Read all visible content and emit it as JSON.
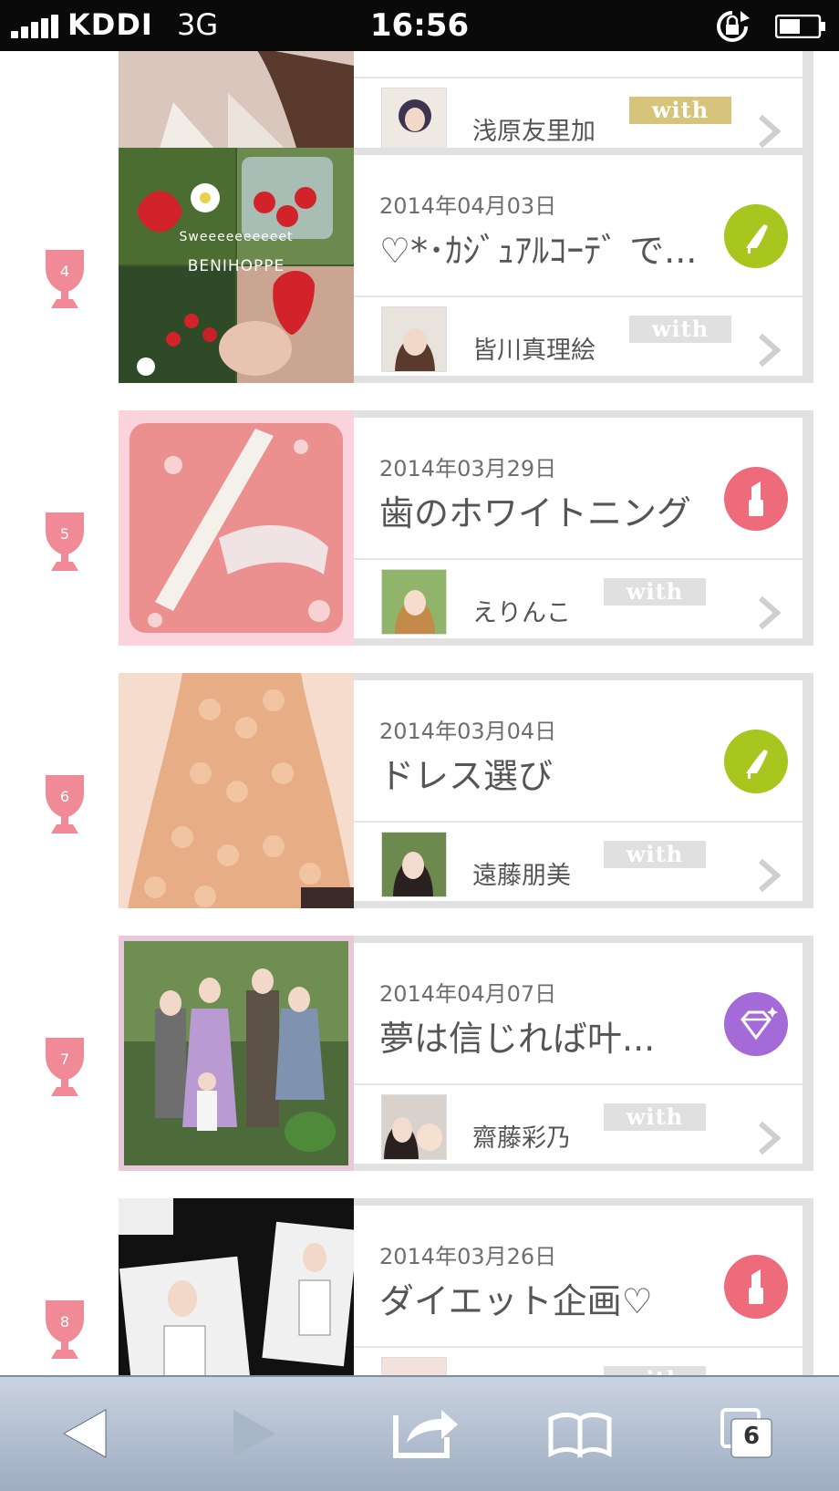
{
  "status_bar": {
    "carrier": "KDDI",
    "network": "3G",
    "time": "16:56"
  },
  "colors": {
    "rank_pink": "#f08a96",
    "shoe_green": "#a8c61d",
    "lipstick_pink": "#ee6b7c",
    "diamond_purple": "#a36ad8"
  },
  "list": {
    "items": [
      {
        "rank": "",
        "date": "",
        "title": "",
        "author": "浅原友里加",
        "with_label": "with",
        "category_icon": "none"
      },
      {
        "rank": "4",
        "date": "2014年04月03日",
        "title": "♡*･ｶｼﾞｭｱﾙｺｰﾃﾞ で...",
        "author": "皆川真理絵",
        "with_label": "with",
        "category_icon": "shoe-icon",
        "thumb_caption_1": "Sweeeeeeeeeet",
        "thumb_caption_2": "BENIHOPPE"
      },
      {
        "rank": "5",
        "date": "2014年03月29日",
        "title": "歯のホワイトニング",
        "author": "えりんこ",
        "with_label": "with",
        "category_icon": "lipstick-icon"
      },
      {
        "rank": "6",
        "date": "2014年03月04日",
        "title": "ドレス選び",
        "author": "遠藤朋美",
        "with_label": "with",
        "category_icon": "shoe-icon"
      },
      {
        "rank": "7",
        "date": "2014年04月07日",
        "title": "夢は信じれば叶...",
        "author": "齋藤彩乃",
        "with_label": "with",
        "category_icon": "diamond-icon"
      },
      {
        "rank": "8",
        "date": "2014年03月26日",
        "title": "ダイエット企画♡",
        "author": "",
        "with_label": "with",
        "category_icon": "lipstick-icon"
      }
    ]
  },
  "toolbar": {
    "tabs_count": "6"
  }
}
